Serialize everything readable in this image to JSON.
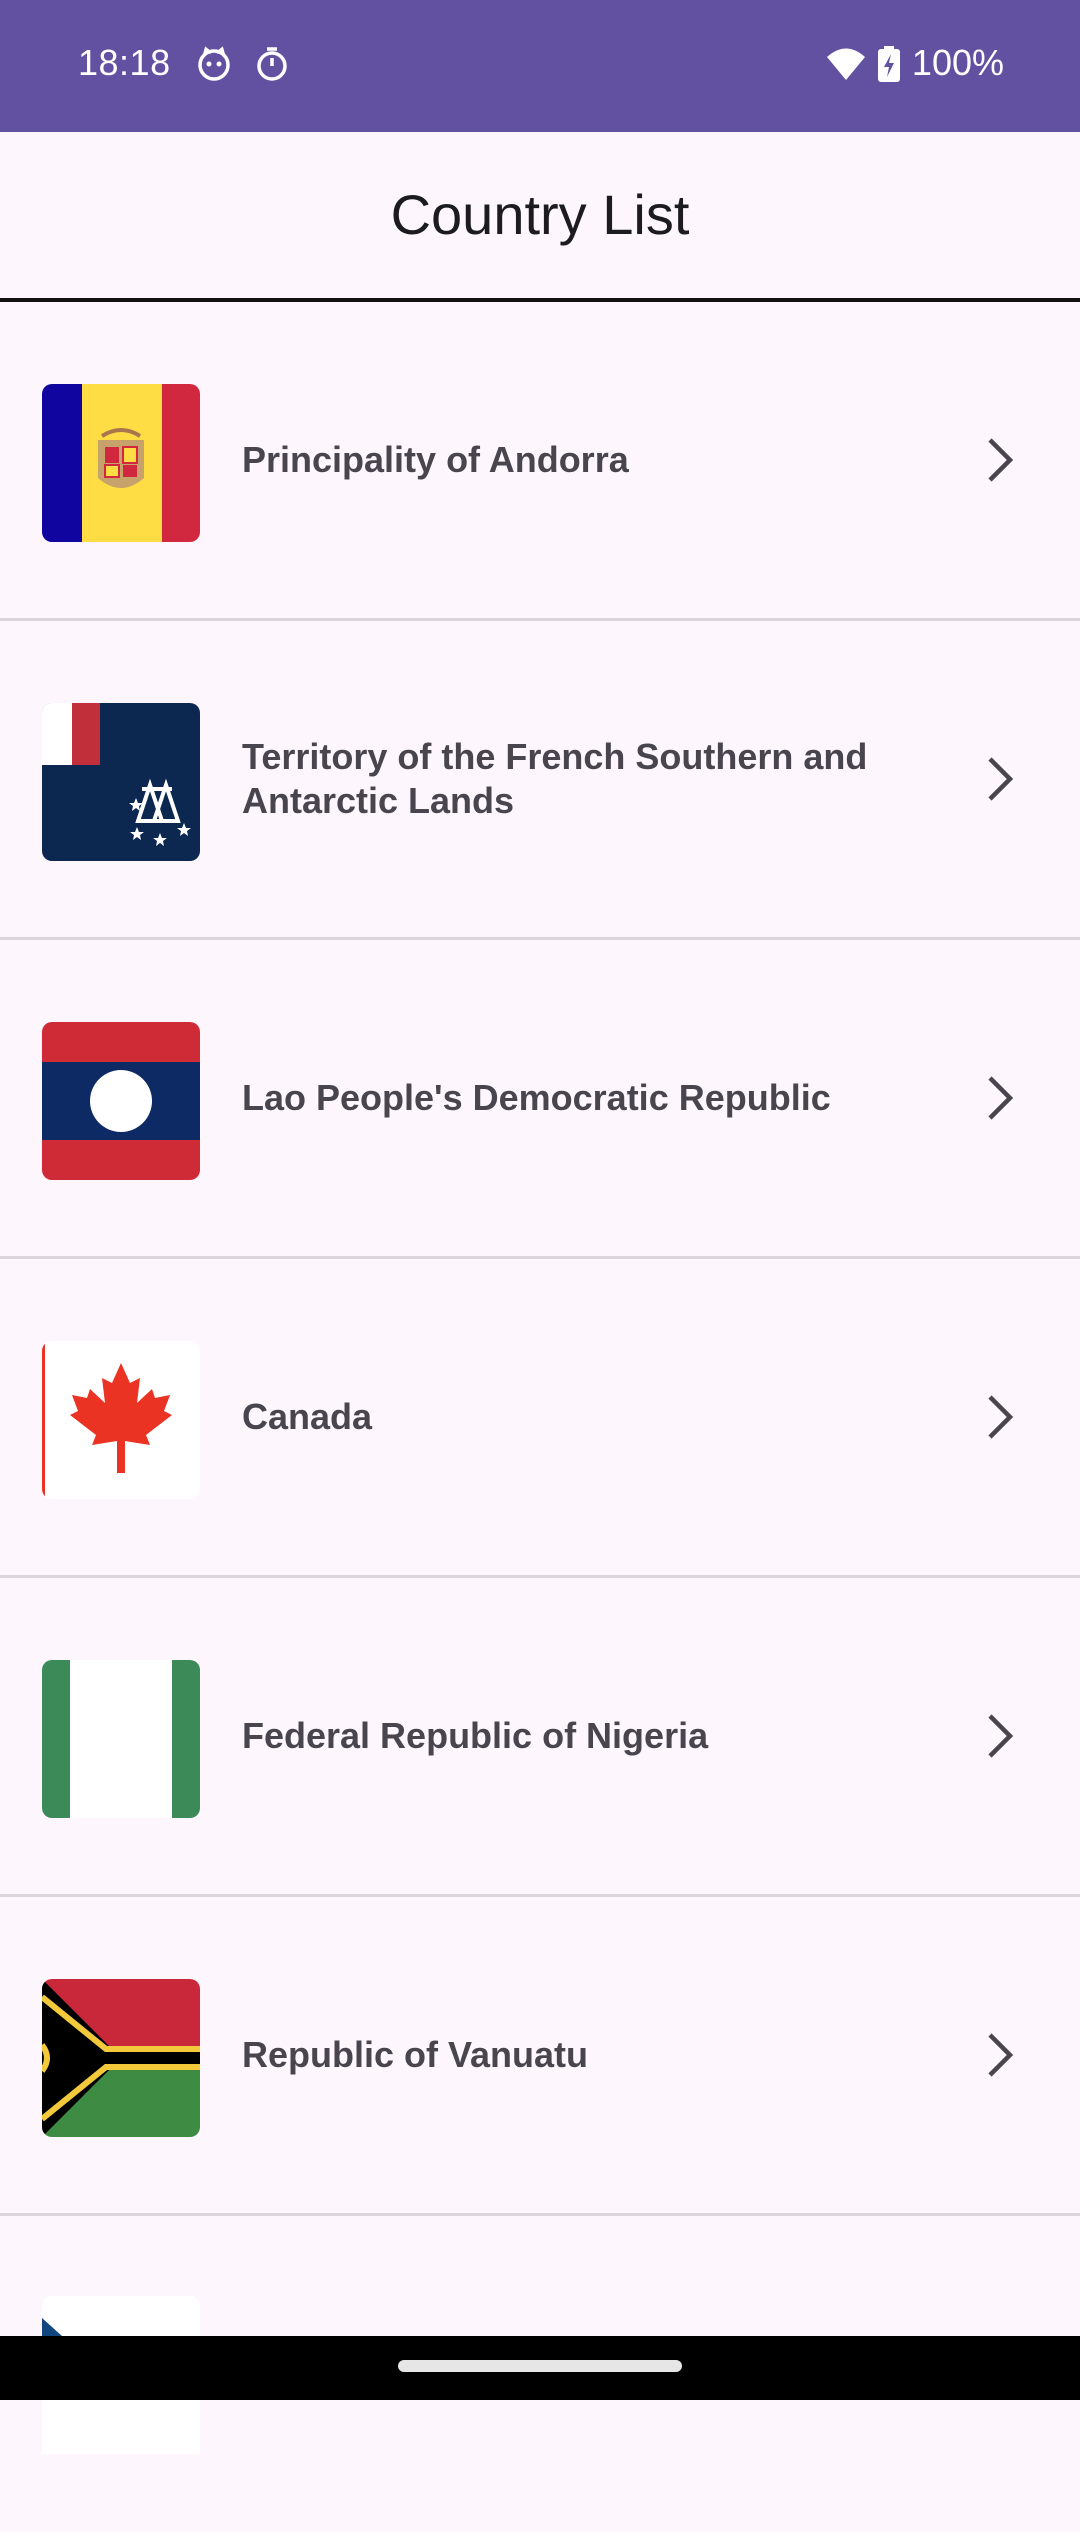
{
  "status_bar": {
    "time": "18:18",
    "battery_percent": "100%",
    "icons": [
      "notification-cat-icon",
      "timer-icon",
      "wifi-icon",
      "battery-charging-icon"
    ]
  },
  "app_bar": {
    "title": "Country List"
  },
  "countries": [
    {
      "name": "Principality of Andorra",
      "flag": "andorra-flag-icon"
    },
    {
      "name": "Territory of the French Southern and Antarctic Lands",
      "flag": "french-southern-lands-flag-icon"
    },
    {
      "name": "Lao People's Democratic Republic",
      "flag": "laos-flag-icon"
    },
    {
      "name": "Canada",
      "flag": "canada-flag-icon"
    },
    {
      "name": "Federal Republic of Nigeria",
      "flag": "nigeria-flag-icon"
    },
    {
      "name": "Republic of Vanuatu",
      "flag": "vanuatu-flag-icon"
    }
  ],
  "colors": {
    "status_bar": "#6251a1",
    "background": "#fdf7fd",
    "label_text": "#49454f"
  }
}
